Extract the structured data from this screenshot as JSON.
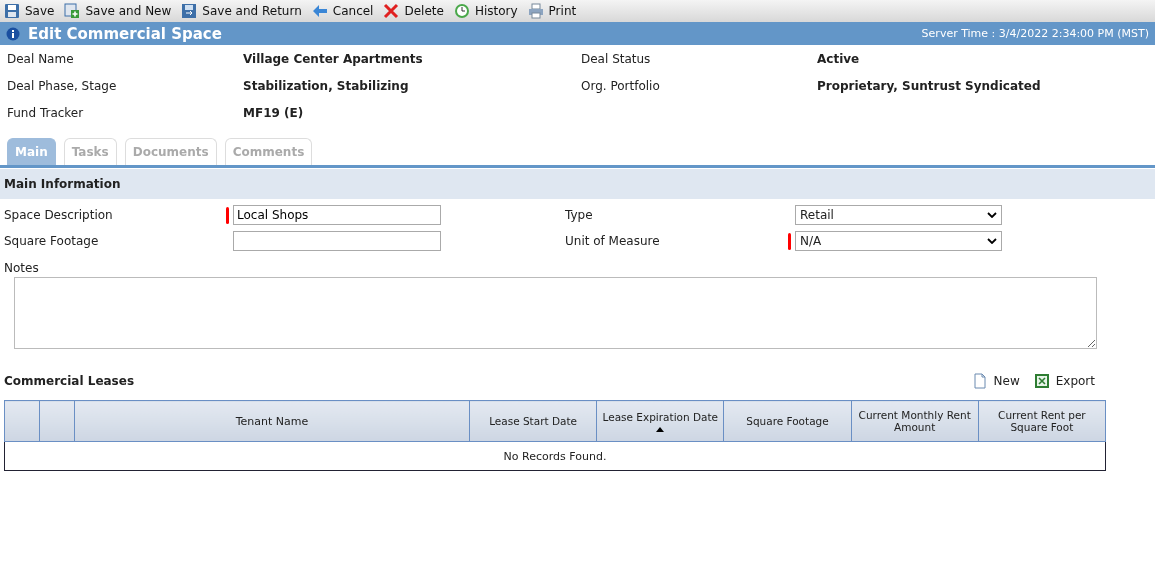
{
  "toolbar": [
    {
      "label": "Save",
      "kind": "save"
    },
    {
      "label": "Save and New",
      "kind": "save-new"
    },
    {
      "label": "Save and Return",
      "kind": "save-return"
    },
    {
      "label": "Cancel",
      "kind": "cancel"
    },
    {
      "label": "Delete",
      "kind": "delete"
    },
    {
      "label": "History",
      "kind": "history"
    },
    {
      "label": "Print",
      "kind": "print"
    }
  ],
  "header": {
    "title": "Edit Commercial Space",
    "server_time": "Server Time : 3/4/2022 2:34:00 PM (MST)"
  },
  "deal_info": [
    {
      "label": "Deal Name",
      "value": "Village Center Apartments"
    },
    {
      "label": "Deal Status",
      "value": "Active"
    },
    {
      "label": "Deal Phase, Stage",
      "value": "Stabilization, Stabilizing"
    },
    {
      "label": "Org. Portfolio",
      "value": "Proprietary, Suntrust Syndicated"
    },
    {
      "label": "Fund Tracker",
      "value": "MF19 (E)"
    }
  ],
  "tabs": [
    {
      "label": "Main",
      "selected": true
    },
    {
      "label": "Tasks",
      "selected": false
    },
    {
      "label": "Documents",
      "selected": false
    },
    {
      "label": "Comments",
      "selected": false
    }
  ],
  "section_title": "Main Information",
  "fields": [
    {
      "label": "Space Description",
      "kind": "text",
      "value": "Local Shops",
      "required": true
    },
    {
      "label": "Type",
      "kind": "select",
      "value": "Retail",
      "required": false
    },
    {
      "label": "Square Footage",
      "kind": "text",
      "required": false
    },
    {
      "label": "Unit of Measure",
      "kind": "select",
      "value": "N/A",
      "required": true
    }
  ],
  "notes": {
    "label": "Notes"
  },
  "leases": {
    "title": "Commercial Leases",
    "actions": [
      {
        "label": "New",
        "kind": "new"
      },
      {
        "label": "Export",
        "kind": "export"
      }
    ],
    "columns": [
      {
        "sorted_ascending": false
      },
      {
        "sorted_ascending": false
      },
      {
        "label": "Tenant Name",
        "sorted_ascending": false
      },
      {
        "label": "Lease Start Date",
        "sorted_ascending": false
      },
      {
        "label": "Lease Expiration Date",
        "sorted_ascending": true
      },
      {
        "label": "Square Footage",
        "sorted_ascending": false
      },
      {
        "label": "Current Monthly Rent Amount",
        "sorted_ascending": false
      },
      {
        "label": "Current Rent per Square Foot",
        "sorted_ascending": false
      }
    ],
    "empty_message": "No Records Found."
  }
}
